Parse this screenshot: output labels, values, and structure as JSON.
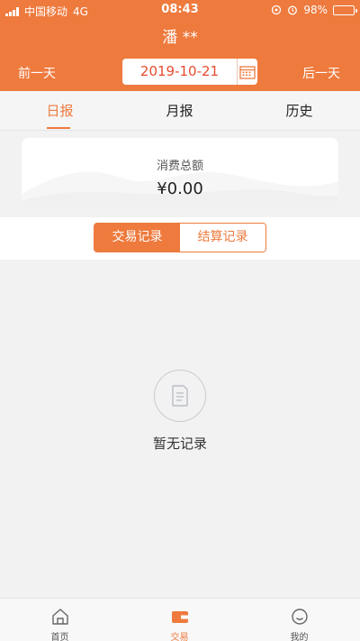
{
  "status_bar": {
    "carrier": "中国移动",
    "network": "4G",
    "time": "08:43",
    "battery": "98%"
  },
  "header": {
    "title": "潘 **"
  },
  "date_bar": {
    "prev_label": "前一天",
    "date": "2019-10-21",
    "next_label": "后一天"
  },
  "tabs": [
    {
      "label": "日报",
      "active": true
    },
    {
      "label": "月报",
      "active": false
    },
    {
      "label": "历史",
      "active": false
    }
  ],
  "summary": {
    "label": "消费总额",
    "value": "¥0.00"
  },
  "record_toggle": {
    "options": [
      "交易记录",
      "结算记录"
    ],
    "selected": "交易记录"
  },
  "empty_state": {
    "icon": "document-icon",
    "text": "暂无记录"
  },
  "bottom_nav": [
    {
      "label": "首页",
      "icon": "home-icon",
      "active": false
    },
    {
      "label": "交易",
      "icon": "wallet-icon",
      "active": true
    },
    {
      "label": "我的",
      "icon": "face-icon",
      "active": false
    }
  ],
  "colors": {
    "accent": "#ee7a3d",
    "date_text": "#e64c2f",
    "background": "#f2f2f2"
  }
}
